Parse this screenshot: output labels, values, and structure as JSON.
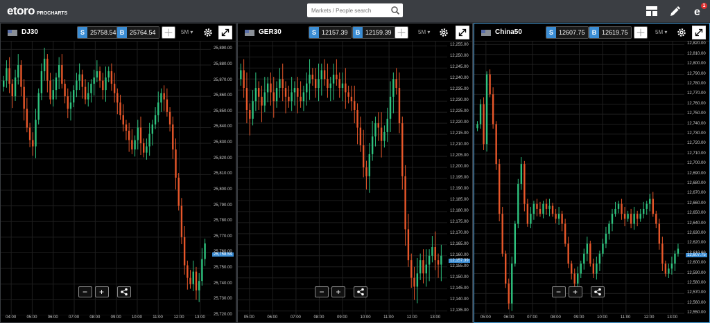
{
  "app": {
    "brand": "etoro",
    "sub": "PROCHARTS"
  },
  "search": {
    "placeholder": "Markets / People search"
  },
  "icons": {
    "layout": "layout-icon",
    "edit": "pencil-icon",
    "notifications": "notification-icon",
    "search": "search-icon"
  },
  "notifications": {
    "count": "1"
  },
  "colors": {
    "up": "#2ec27e",
    "down": "#e8572a",
    "accent": "#3b8dd4"
  },
  "panels": [
    {
      "symbol": "DJ30",
      "sell_label": "S",
      "sell": "25758.54",
      "buy_label": "B",
      "buy": "25764.54",
      "timeframe": "5M",
      "chart_data": {
        "type": "candlestick",
        "y_ticks": [
          "25,890.00",
          "25,880.00",
          "25,870.00",
          "25,860.00",
          "25,850.00",
          "25,840.00",
          "25,830.00",
          "25,820.00",
          "25,810.00",
          "25,800.00",
          "25,790.00",
          "25,780.00",
          "25,770.00",
          "25,760.00",
          "25,750.00",
          "25,740.00",
          "25,730.00",
          "25,720.00"
        ],
        "ylim": [
          25720,
          25895
        ],
        "last_price": "25,758.54",
        "x_ticks": [
          "04:00",
          "05:00",
          "06:00",
          "07:00",
          "08:00",
          "09:00",
          "10:00",
          "11:00",
          "12:00",
          "13:00"
        ],
        "close": [
          25870,
          25878,
          25868,
          25860,
          25872,
          25880,
          25866,
          25852,
          25840,
          25832,
          25828,
          25845,
          25862,
          25876,
          25884,
          25870,
          25858,
          25864,
          25872,
          25880,
          25868,
          25860,
          25852,
          25856,
          25864,
          25870,
          25874,
          25866,
          25858,
          25862,
          25868,
          25872,
          25876,
          25870,
          25864,
          25872,
          25876,
          25868,
          25862,
          25856,
          25848,
          25842,
          25838,
          25832,
          25826,
          25832,
          25840,
          25830,
          25824,
          25828,
          25836,
          25842,
          25848,
          25856,
          25862,
          25858,
          25850,
          25842,
          25826,
          25808,
          25790,
          25770,
          25752,
          25744,
          25740,
          25748,
          25736,
          25742,
          25756,
          25766
        ]
      }
    },
    {
      "symbol": "GER30",
      "sell_label": "S",
      "sell": "12157.39",
      "buy_label": "B",
      "buy": "12159.39",
      "timeframe": "5M",
      "chart_data": {
        "type": "candlestick",
        "y_ticks": [
          "12,255.00",
          "12,250.00",
          "12,245.00",
          "12,240.00",
          "12,235.00",
          "12,230.00",
          "12,225.00",
          "12,220.00",
          "12,215.00",
          "12,210.00",
          "12,205.00",
          "12,200.00",
          "12,195.00",
          "12,190.00",
          "12,185.00",
          "12,180.00",
          "12,175.00",
          "12,170.00",
          "12,165.00",
          "12,160.00",
          "12,155.00",
          "12,150.00",
          "12,145.00",
          "12,140.00",
          "12,135.00"
        ],
        "ylim": [
          12133,
          12257
        ],
        "last_price": "12,157.39",
        "x_ticks": [
          "05:00",
          "06:00",
          "07:00",
          "08:00",
          "09:00",
          "10:00",
          "11:00",
          "12:00",
          "13:00"
        ],
        "close": [
          12244,
          12236,
          12226,
          12222,
          12230,
          12236,
          12232,
          12228,
          12234,
          12238,
          12234,
          12230,
          12236,
          12240,
          12236,
          12232,
          12230,
          12234,
          12236,
          12232,
          12230,
          12234,
          12238,
          12242,
          12240,
          12236,
          12240,
          12244,
          12240,
          12236,
          12238,
          12242,
          12240,
          12236,
          12238,
          12234,
          12232,
          12230,
          12226,
          12218,
          12210,
          12200,
          12196,
          12206,
          12214,
          12220,
          12218,
          12212,
          12216,
          12222,
          12232,
          12240,
          12236,
          12220,
          12196,
          12172,
          12158,
          12150,
          12146,
          12152,
          12158,
          12152,
          12156,
          12160,
          12164,
          12158,
          12156,
          12160
        ]
      }
    },
    {
      "symbol": "China50",
      "sell_label": "S",
      "sell": "12607.75",
      "buy_label": "B",
      "buy": "12619.75",
      "timeframe": "5M",
      "chart_data": {
        "type": "candlestick",
        "y_ticks": [
          "12,820.00",
          "12,810.00",
          "12,800.00",
          "12,790.00",
          "12,780.00",
          "12,770.00",
          "12,760.00",
          "12,750.00",
          "12,740.00",
          "12,730.00",
          "12,720.00",
          "12,710.00",
          "12,700.00",
          "12,690.00",
          "12,680.00",
          "12,670.00",
          "12,660.00",
          "12,650.00",
          "12,640.00",
          "12,630.00",
          "12,620.00",
          "12,610.00",
          "12,600.00",
          "12,590.00",
          "12,580.00",
          "12,570.00",
          "12,560.00",
          "12,550.00"
        ],
        "ylim": [
          12548,
          12823
        ],
        "last_price": "12,607.75",
        "x_ticks": [
          "05:00",
          "06:00",
          "07:00",
          "08:00",
          "09:00",
          "10:00",
          "11:00",
          "12:00",
          "13:00"
        ],
        "close": [
          12740,
          12760,
          12720,
          12790,
          12770,
          12740,
          12700,
          12650,
          12610,
          12580,
          12560,
          12600,
          12640,
          12680,
          12700,
          12660,
          12640,
          12650,
          12660,
          12655,
          12650,
          12660,
          12655,
          12658,
          12650,
          12645,
          12650,
          12640,
          12620,
          12600,
          12590,
          12580,
          12590,
          12600,
          12610,
          12620,
          12600,
          12590,
          12600,
          12610,
          12620,
          12630,
          12640,
          12650,
          12655,
          12660,
          12650,
          12645,
          12650,
          12640,
          12650,
          12645,
          12650,
          12655,
          12660,
          12665,
          12650,
          12640,
          12620,
          12600,
          12590,
          12595,
          12600,
          12610,
          12615
        ]
      }
    }
  ]
}
